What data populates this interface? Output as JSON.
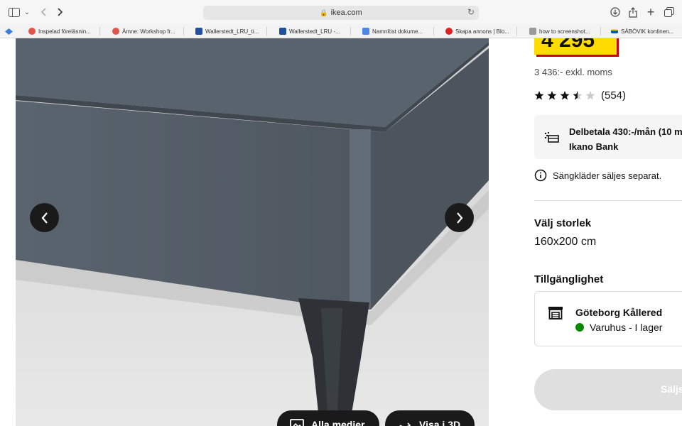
{
  "browser": {
    "url": "ikea.com",
    "bookmarks": [
      {
        "label": "Inspelad föreläsnin...",
        "color": "#e2554a"
      },
      {
        "label": "Ämne: Workshop fr...",
        "color": "#e2554a"
      },
      {
        "label": "Wallerstedt_LRU_ti...",
        "color": "#1e4fa0"
      },
      {
        "label": "Wallerstedt_LRU -...",
        "color": "#1e4fa0"
      },
      {
        "label": "Namnlöst dokume...",
        "color": "#4a86e8"
      },
      {
        "label": "Skapa annons | Blo...",
        "color": "#e02020"
      },
      {
        "label": "how to screenshot...",
        "color": "#9a9a9a"
      },
      {
        "label": "SÄBÖVIK kontinen...",
        "color": "#0058a3"
      }
    ]
  },
  "gallery": {
    "buttons": {
      "all_media": "Alla medier",
      "view_3d": "Visa i 3D"
    }
  },
  "product": {
    "price": "4 295",
    "price_suffix": ":-",
    "price_excl": "3 436:- exkl. moms",
    "rating": 3.5,
    "rating_max": 5,
    "reviews": "(554)",
    "payment_line1": "Delbetala 430:-/mån (10 m",
    "payment_line2": "Ikano Bank",
    "bedding_note": "Sängkläder säljes separat.",
    "size_heading": "Välj storlek",
    "size_value": "160x200 cm",
    "availability_heading": "Tillgänglighet",
    "store_name": "Göteborg Kållered",
    "stock_status": "Varuhus - I lager",
    "stock_color": "#0a8a00",
    "cta_label": "Säljs"
  },
  "colors": {
    "price_box": "#ffdb00",
    "price_shadow": "#cc0008",
    "bed_fabric": "#56606a"
  }
}
